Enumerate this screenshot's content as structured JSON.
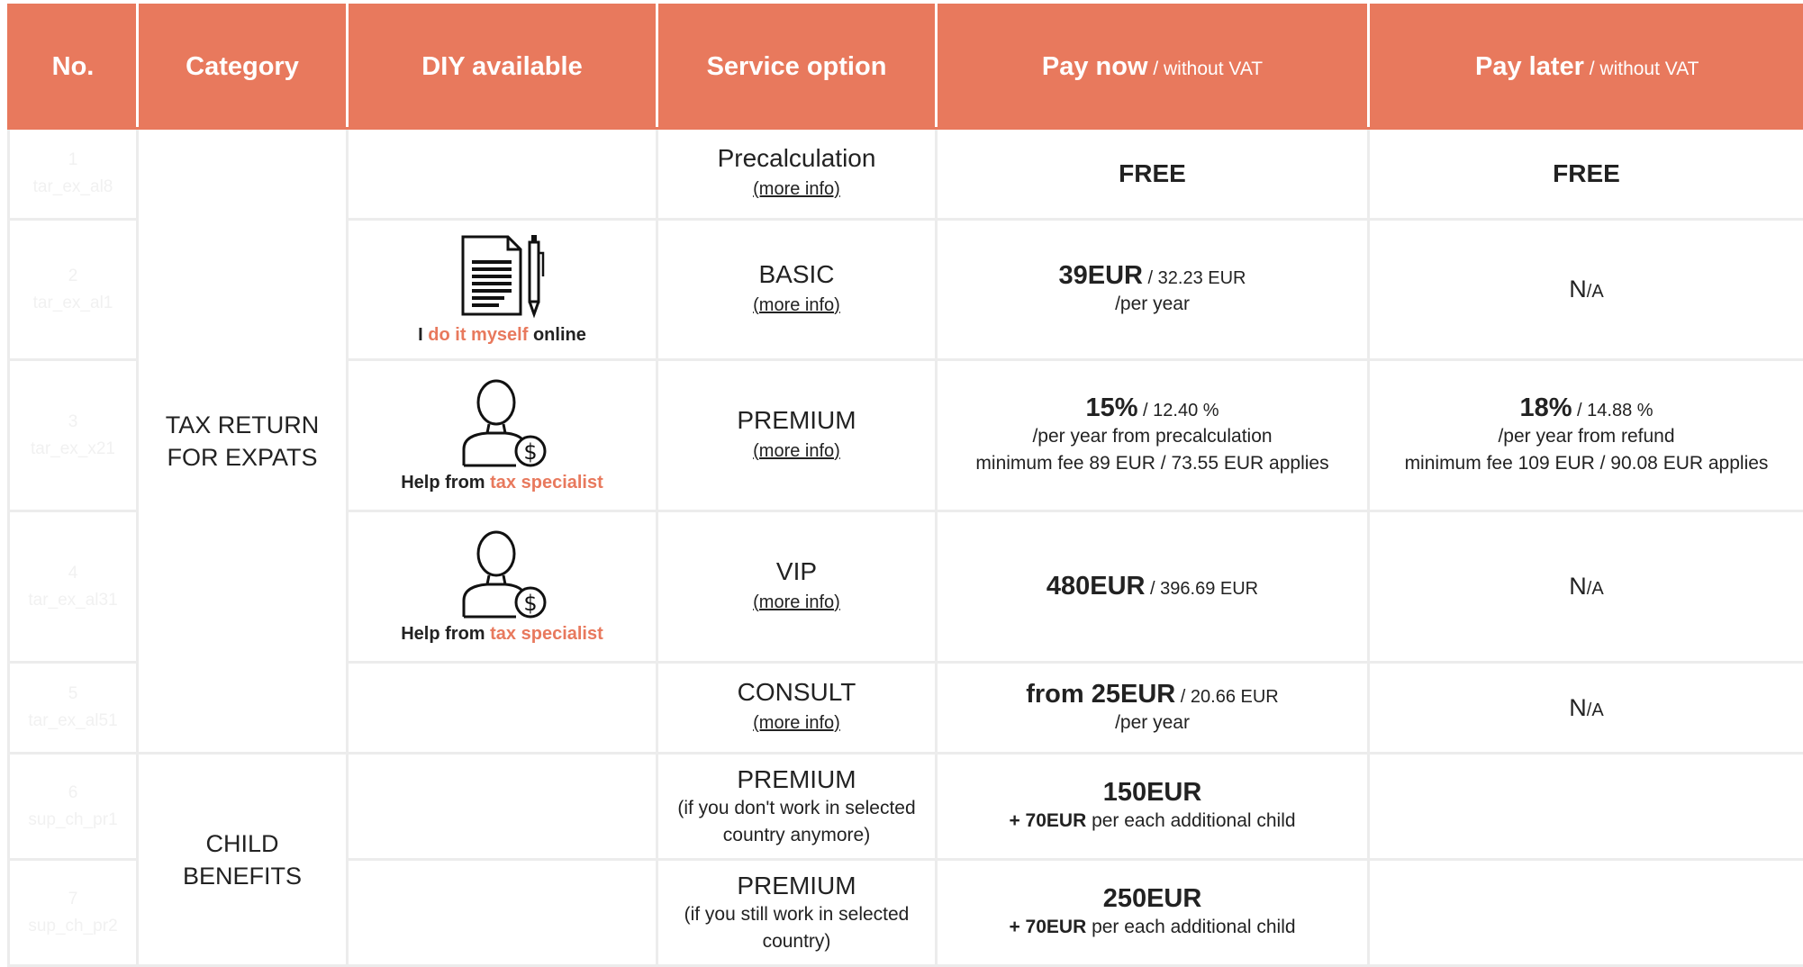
{
  "header": {
    "no": "No.",
    "category": "Category",
    "diy": "DIY available",
    "service": "Service option",
    "pay_now": "Pay now",
    "pay_now_sub": " / without VAT",
    "pay_later": "Pay later",
    "pay_later_sub": " / without VAT"
  },
  "categories": {
    "expats": "TAX RETURN FOR EXPATS",
    "child": "CHILD BENEFITS"
  },
  "rows": [
    {
      "no": "1",
      "code": "tar_ex_al8",
      "service": "Precalculation",
      "more": "(more info)",
      "pay_now": "FREE",
      "pay_later": "FREE"
    },
    {
      "no": "2",
      "code": "tar_ex_al1",
      "diy_a": "I ",
      "diy_b": "do it myself",
      "diy_c": " online",
      "service": "BASIC",
      "more": "(more info)",
      "pay_now_big": "39EUR",
      "pay_now_small": " / 32.23 EUR",
      "pay_now_line1": "/per year",
      "pay_later_na": "N",
      "pay_later_na_small": "/A"
    },
    {
      "no": "3",
      "code": "tar_ex_x21",
      "diy_a": "Help from ",
      "diy_b": "tax specialist",
      "service": "PREMIUM",
      "more": "(more info)",
      "pay_now_big": "15%",
      "pay_now_small": " / 12.40 %",
      "pay_now_line1": "/per year from precalculation",
      "pay_now_line2": "minimum fee 89 EUR / 73.55 EUR applies",
      "pay_later_big": "18%",
      "pay_later_small": " / 14.88 %",
      "pay_later_line1": "/per year from refund",
      "pay_later_line2": "minimum fee 109 EUR / 90.08 EUR applies"
    },
    {
      "no": "4",
      "code": "tar_ex_al31",
      "diy_a": "Help from ",
      "diy_b": "tax specialist",
      "service": "VIP",
      "more": "(more info)",
      "pay_now_big": "480EUR",
      "pay_now_small": " / 396.69 EUR",
      "pay_later_na": "N",
      "pay_later_na_small": "/A"
    },
    {
      "no": "5",
      "code": "tar_ex_al51",
      "service": "CONSULT",
      "more": "(more info)",
      "pay_now_big": "from 25EUR",
      "pay_now_small": " / 20.66 EUR",
      "pay_now_line1": "/per year",
      "pay_later_na": "N",
      "pay_later_na_small": "/A"
    },
    {
      "no": "6",
      "code": "sup_ch_pr1",
      "service": "PREMIUM",
      "note": "(if you don't work in selected country anymore)",
      "pay_now_big": "150EUR",
      "pay_now_extra_bold": "+ 70EUR",
      "pay_now_extra": " per each additional child"
    },
    {
      "no": "7",
      "code": "sup_ch_pr2",
      "service": "PREMIUM",
      "note": "(if you still work in selected country)",
      "pay_now_big": "250EUR",
      "pay_now_extra_bold": "+ 70EUR",
      "pay_now_extra": " per each additional child"
    }
  ],
  "icons": {
    "diy": "document-pen-icon",
    "specialist": "person-dollar-icon"
  },
  "colors": {
    "accent": "#e8795d",
    "header_text": "#ffffff",
    "border": "#ececec"
  }
}
